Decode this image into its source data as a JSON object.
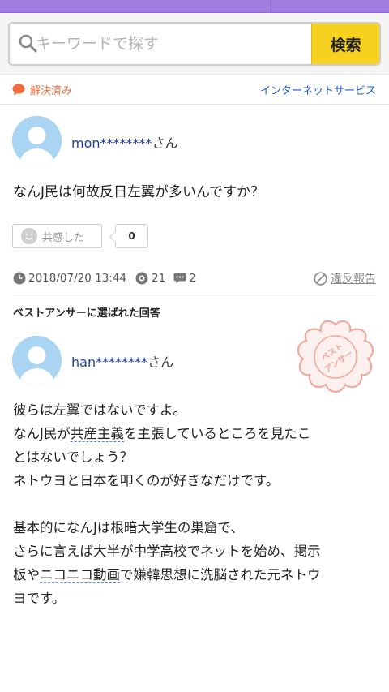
{
  "search": {
    "placeholder": "キーワードで探す",
    "button_label": "検索"
  },
  "status": {
    "resolved_label": "解決済み",
    "category_label": "インターネットサービス"
  },
  "question": {
    "username": "mon********",
    "honorific": "さん",
    "text": "なんJ民は何故反日左翼が多いんですか？",
    "empathy_label": "共感した",
    "empathy_count": "0",
    "date": "2018/07/20 13:44",
    "views": "21",
    "answers": "2",
    "report_label": "違反報告"
  },
  "best_answer": {
    "heading": "ベストアンサーに選ばれた回答",
    "username": "han********",
    "honorific": "さん",
    "stamp_text": "ベストアンサー",
    "lines": {
      "l1": "彼らは左翼ではないですよ。",
      "l2_a": "なんJ民が",
      "l2_kw": "共産主義",
      "l2_b": "を主張しているところを見たこ",
      "l3": "とはないでしょう？",
      "l4": "ネトウヨと日本を叩くのが好きなだけです。",
      "l5": "基本的になんJは根暗大学生の巣窟で、",
      "l6": "さらに言えば大半が中学高校でネットを始め、掲示",
      "l7_a": "板や",
      "l7_kw": "ニコニコ動画",
      "l7_b": "で嫌韓思想に洗脳された元ネトウ",
      "l8": "ヨです。"
    }
  },
  "colors": {
    "top_bar": "#a27be0",
    "search_button": "#f6d21e",
    "link": "#1f5bc6",
    "resolved": "#f06b3c",
    "username": "#1f3fa8"
  }
}
